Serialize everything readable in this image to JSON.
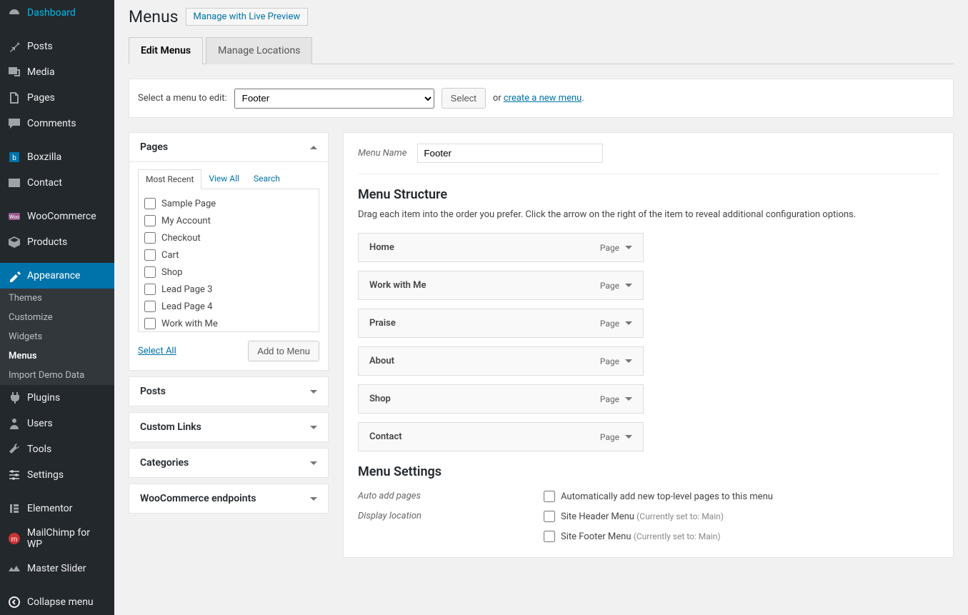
{
  "sidebar": {
    "items": [
      {
        "label": "Dashboard",
        "icon": "dashboard"
      },
      {
        "label": "Posts",
        "icon": "pin"
      },
      {
        "label": "Media",
        "icon": "media"
      },
      {
        "label": "Pages",
        "icon": "pages"
      },
      {
        "label": "Comments",
        "icon": "comments"
      },
      {
        "label": "Boxzilla",
        "icon": "box"
      },
      {
        "label": "Contact",
        "icon": "mail"
      },
      {
        "label": "WooCommerce",
        "icon": "woo"
      },
      {
        "label": "Products",
        "icon": "products"
      },
      {
        "label": "Appearance",
        "icon": "appearance",
        "active": true,
        "submenu": [
          {
            "label": "Themes"
          },
          {
            "label": "Customize"
          },
          {
            "label": "Widgets"
          },
          {
            "label": "Menus",
            "active": true
          },
          {
            "label": "Import Demo Data"
          }
        ]
      },
      {
        "label": "Plugins",
        "icon": "plugins"
      },
      {
        "label": "Users",
        "icon": "users"
      },
      {
        "label": "Tools",
        "icon": "tools"
      },
      {
        "label": "Settings",
        "icon": "settings"
      },
      {
        "label": "Elementor",
        "icon": "elementor"
      },
      {
        "label": "MailChimp for WP",
        "icon": "mailchimp"
      },
      {
        "label": "Master Slider",
        "icon": "masterslider"
      },
      {
        "label": "Collapse menu",
        "icon": "collapse"
      }
    ]
  },
  "page": {
    "title": "Menus",
    "header_link": "Manage with Live Preview",
    "tabs": [
      {
        "label": "Edit Menus",
        "active": true
      },
      {
        "label": "Manage Locations"
      }
    ]
  },
  "select_bar": {
    "label": "Select a menu to edit:",
    "selected": "Footer",
    "select_btn": "Select",
    "or": "or",
    "create_link": "create a new menu",
    "period": "."
  },
  "accordion": [
    {
      "title": "Pages",
      "expanded": true,
      "tabs": [
        {
          "label": "Most Recent",
          "active": true
        },
        {
          "label": "View All"
        },
        {
          "label": "Search"
        }
      ],
      "items": [
        "Sample Page",
        "My Account",
        "Checkout",
        "Cart",
        "Shop",
        "Lead Page 3",
        "Lead Page 4",
        "Work with Me"
      ],
      "select_all": "Select All",
      "add_btn": "Add to Menu"
    },
    {
      "title": "Posts",
      "expanded": false
    },
    {
      "title": "Custom Links",
      "expanded": false
    },
    {
      "title": "Categories",
      "expanded": false
    },
    {
      "title": "WooCommerce endpoints",
      "expanded": false
    }
  ],
  "menu_editor": {
    "name_label": "Menu Name",
    "name_value": "Footer",
    "structure_title": "Menu Structure",
    "structure_desc": "Drag each item into the order you prefer. Click the arrow on the right of the item to reveal additional configuration options.",
    "items": [
      {
        "title": "Home",
        "type": "Page"
      },
      {
        "title": "Work with Me",
        "type": "Page"
      },
      {
        "title": "Praise",
        "type": "Page"
      },
      {
        "title": "About",
        "type": "Page"
      },
      {
        "title": "Shop",
        "type": "Page"
      },
      {
        "title": "Contact",
        "type": "Page"
      }
    ],
    "settings_title": "Menu Settings",
    "settings": [
      {
        "label": "Auto add pages",
        "options": [
          {
            "text": "Automatically add new top-level pages to this menu"
          }
        ]
      },
      {
        "label": "Display location",
        "options": [
          {
            "text": "Site Header Menu",
            "hint": "(Currently set to: Main)"
          },
          {
            "text": "Site Footer Menu",
            "hint": "(Currently set to: Main)"
          }
        ]
      }
    ]
  }
}
